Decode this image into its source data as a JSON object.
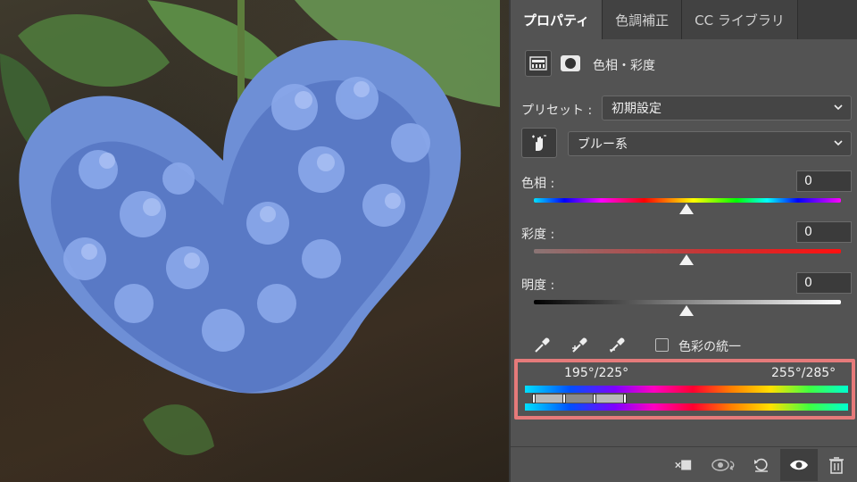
{
  "panel": {
    "tabs": [
      {
        "label": "プロパティ",
        "active": true
      },
      {
        "label": "色調補正",
        "active": false
      },
      {
        "label": "CC ライブラリ",
        "active": false
      }
    ],
    "adjustment_title": "色相・彩度",
    "adjustment_icon": "hue-saturation-icon",
    "mask_icon": "layer-mask-icon",
    "preset_label": "プリセット :",
    "preset_value": "初期設定",
    "channel_value": "ブルー系",
    "target_adjust_icon": "on-image-adjust-hand-icon",
    "hue": {
      "label": "色相 :",
      "value": "0"
    },
    "saturation": {
      "label": "彩度 :",
      "value": "0"
    },
    "lightness": {
      "label": "明度 :",
      "value": "0"
    },
    "eyedroppers": [
      "eyedropper-icon",
      "eyedropper-plus-icon",
      "eyedropper-minus-icon"
    ],
    "colorize_label": "色彩の統一",
    "colorize_checked": false,
    "range_left": "195°/225°",
    "range_right": "255°/285°",
    "highlight_color": "#e57a7a",
    "bottom_icons": [
      "clip-to-layer-icon",
      "view-previous-state-icon",
      "reset-icon",
      "visibility-eye-icon",
      "trash-icon"
    ]
  },
  "photo": {
    "subject_icon": "hydrangea-photo"
  }
}
